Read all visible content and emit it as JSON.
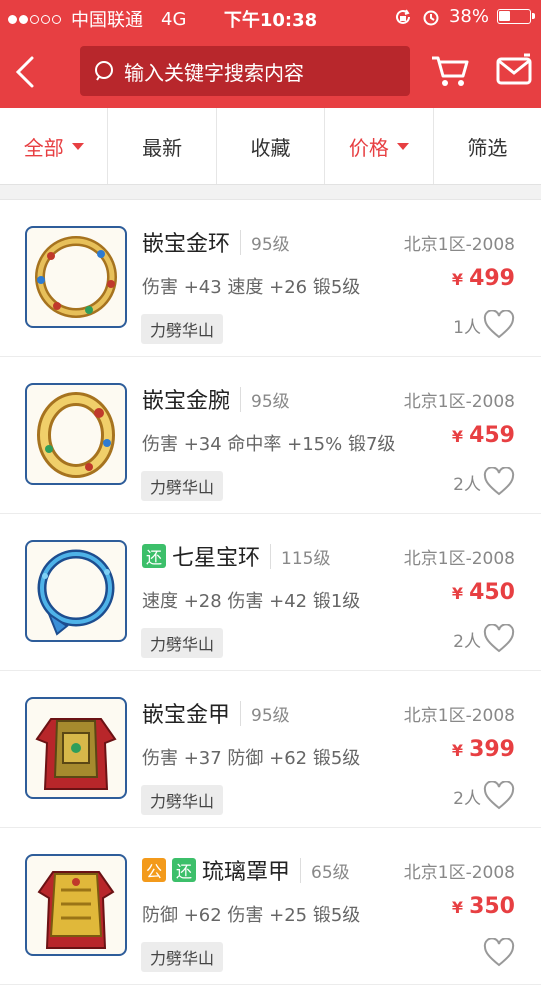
{
  "status": {
    "carrier": "中国联通",
    "network": "4G",
    "time": "下午10:38",
    "battery": "38%",
    "battery_level": 0.38
  },
  "header": {
    "search_placeholder": "输入关键字搜索内容"
  },
  "filters": [
    {
      "label": "全部",
      "active": true
    },
    {
      "label": "最新",
      "active": false
    },
    {
      "label": "收藏",
      "active": false
    },
    {
      "label": "价格",
      "active": true
    },
    {
      "label": "筛选",
      "active": false
    }
  ],
  "items": [
    {
      "name": "嵌宝金环",
      "level": "95级",
      "server": "北京1区-2008",
      "attrs": "伤害 +43 速度 +26 锻5级",
      "price": "499",
      "currency": "¥",
      "tag": "力劈华山",
      "likes": "1人",
      "badges": [],
      "icon": "gold-ring-icon"
    },
    {
      "name": "嵌宝金腕",
      "level": "95级",
      "server": "北京1区-2008",
      "attrs": "伤害 +34 命中率 +15% 锻7级",
      "price": "459",
      "currency": "¥",
      "tag": "力劈华山",
      "likes": "2人",
      "badges": [],
      "icon": "gold-bracelet-icon"
    },
    {
      "name": "七星宝环",
      "level": "115级",
      "server": "北京1区-2008",
      "attrs": "速度 +28 伤害 +42 锻1级",
      "price": "450",
      "currency": "¥",
      "tag": "力劈华山",
      "likes": "2人",
      "badges": [
        "还"
      ],
      "icon": "blue-ring-icon"
    },
    {
      "name": "嵌宝金甲",
      "level": "95级",
      "server": "北京1区-2008",
      "attrs": "伤害 +37 防御 +62 锻5级",
      "price": "399",
      "currency": "¥",
      "tag": "力劈华山",
      "likes": "2人",
      "badges": [],
      "icon": "armor-icon"
    },
    {
      "name": "琉璃罩甲",
      "level": "65级",
      "server": "北京1区-2008",
      "attrs": "防御 +62 伤害 +25 锻5级",
      "price": "350",
      "currency": "¥",
      "tag": "力劈华山",
      "likes": "",
      "badges": [
        "公",
        "还"
      ],
      "icon": "golden-armor-icon"
    }
  ],
  "colors": {
    "brand_red": "#e73f42",
    "badge_gong": "#f39a1b",
    "badge_huan": "#3cbf6a"
  }
}
